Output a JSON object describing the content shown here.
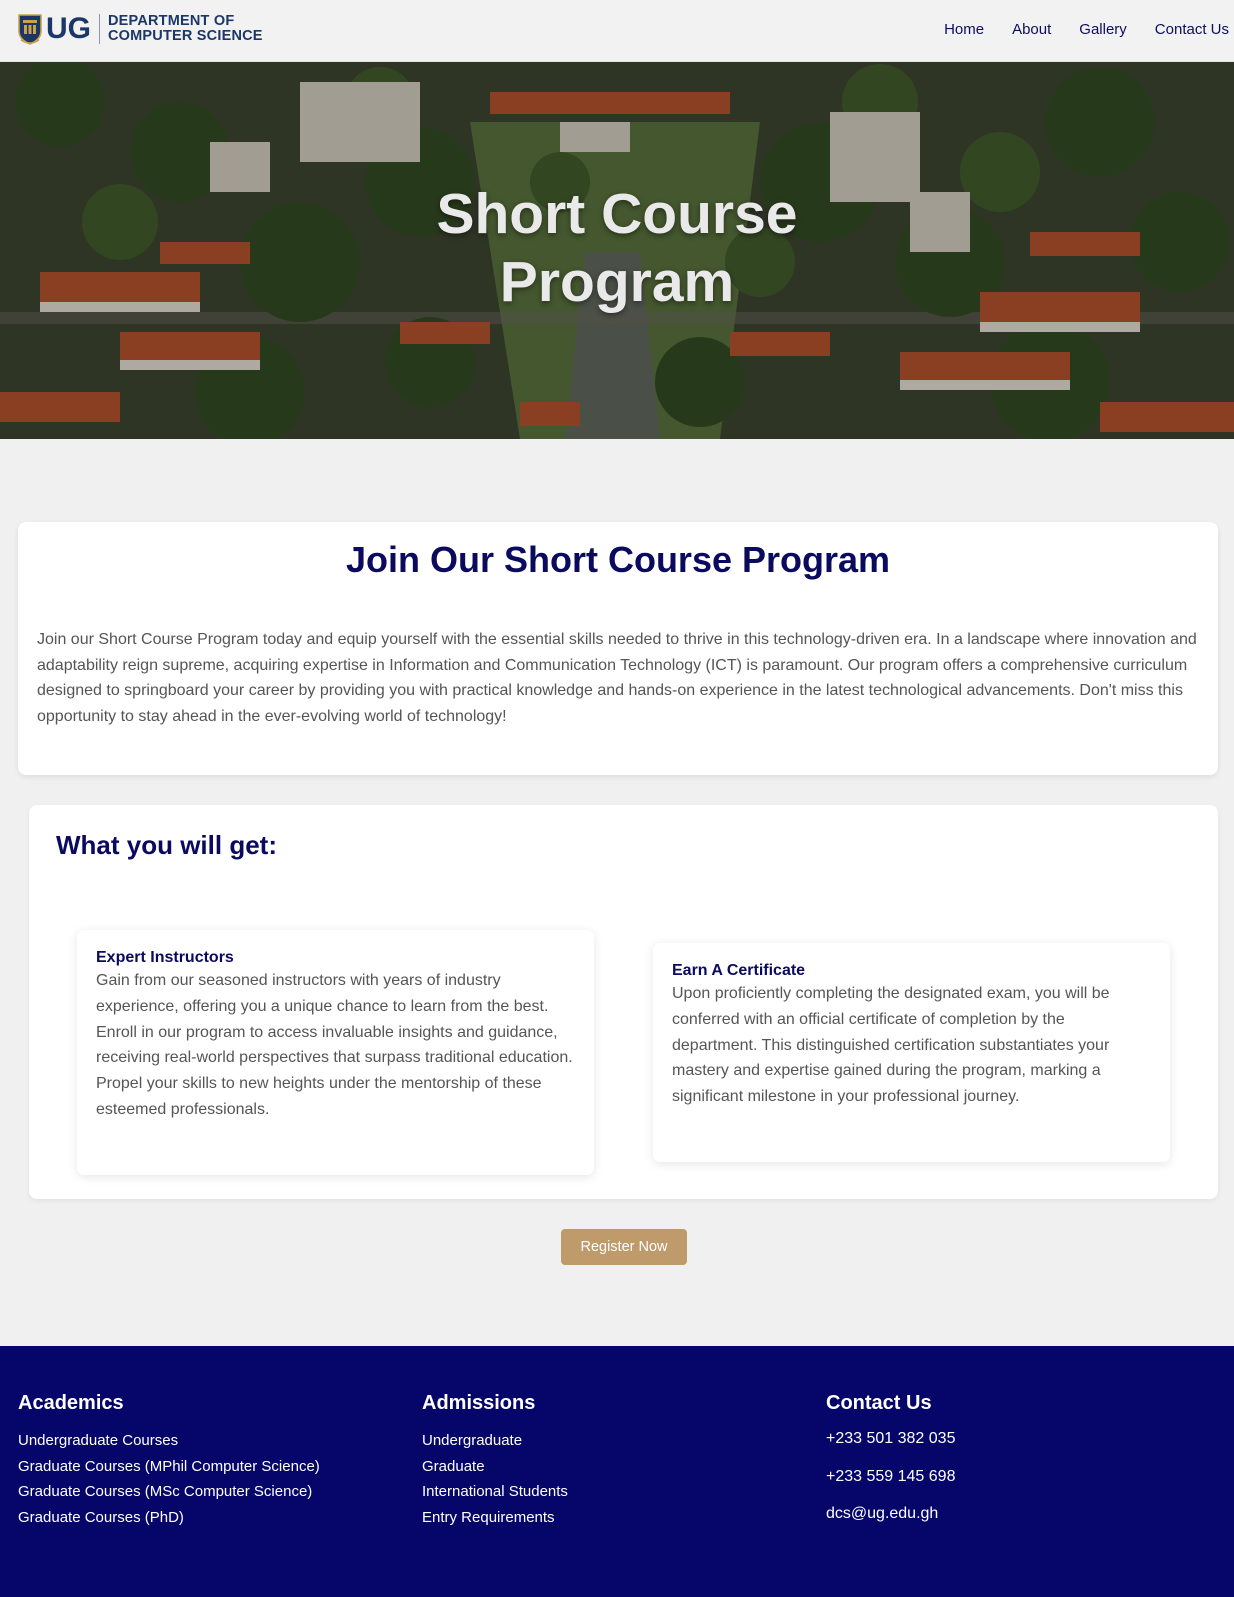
{
  "header": {
    "logo_abbr": "UG",
    "logo_line1": "DEPARTMENT OF",
    "logo_line2": "COMPUTER SCIENCE",
    "nav": [
      "Home",
      "About",
      "Gallery",
      "Contact Us"
    ]
  },
  "hero": {
    "title_line1": "Short Course",
    "title_line2": "Program"
  },
  "intro": {
    "title": "Join Our Short Course Program",
    "text": "Join our Short Course Program today and equip yourself with the essential skills needed to thrive in this technology-driven era. In a landscape where innovation and adaptability reign supreme, acquiring expertise in Information and Communication Technology (ICT) is paramount. Our program offers a comprehensive curriculum designed to springboard your career by providing you with practical knowledge and hands-on experience in the latest technological advancements. Don't miss this opportunity to stay ahead in the ever-evolving world of technology!"
  },
  "benefits": {
    "title": "What you will get:",
    "features": [
      {
        "title": "Expert Instructors",
        "text": "Gain from our seasoned instructors with years of industry experience, offering you a unique chance to learn from the best. Enroll in our program to access invaluable insights and guidance, receiving real-world perspectives that surpass traditional education. Propel your skills to new heights under the mentorship of these esteemed professionals."
      },
      {
        "title": "Earn A Certificate",
        "text": "Upon proficiently completing the designated exam, you will be conferred with an official certificate of completion by the department. This distinguished certification substantiates your mastery and expertise gained during the program, marking a significant milestone in your professional journey."
      }
    ]
  },
  "register": {
    "label": "Register Now"
  },
  "footer": {
    "academics": {
      "title": "Academics",
      "links": [
        "Undergraduate Courses",
        "Graduate Courses (MPhil Computer Science)",
        "Graduate Courses (MSc Computer Science)",
        "Graduate Courses (PhD)"
      ]
    },
    "admissions": {
      "title": "Admissions",
      "links": [
        "Undergraduate",
        "Graduate",
        "International Students",
        "Entry Requirements"
      ]
    },
    "contact": {
      "title": "Contact Us",
      "phone1": "+233 501 382 035",
      "phone2": "+233 559 145 698",
      "email": "dcs@ug.edu.gh"
    }
  },
  "colors": {
    "navy": "#0a0a5e",
    "footer_bg": "#05056a",
    "accent_gold": "#bf9b6b",
    "page_bg": "#f0f0f0"
  }
}
